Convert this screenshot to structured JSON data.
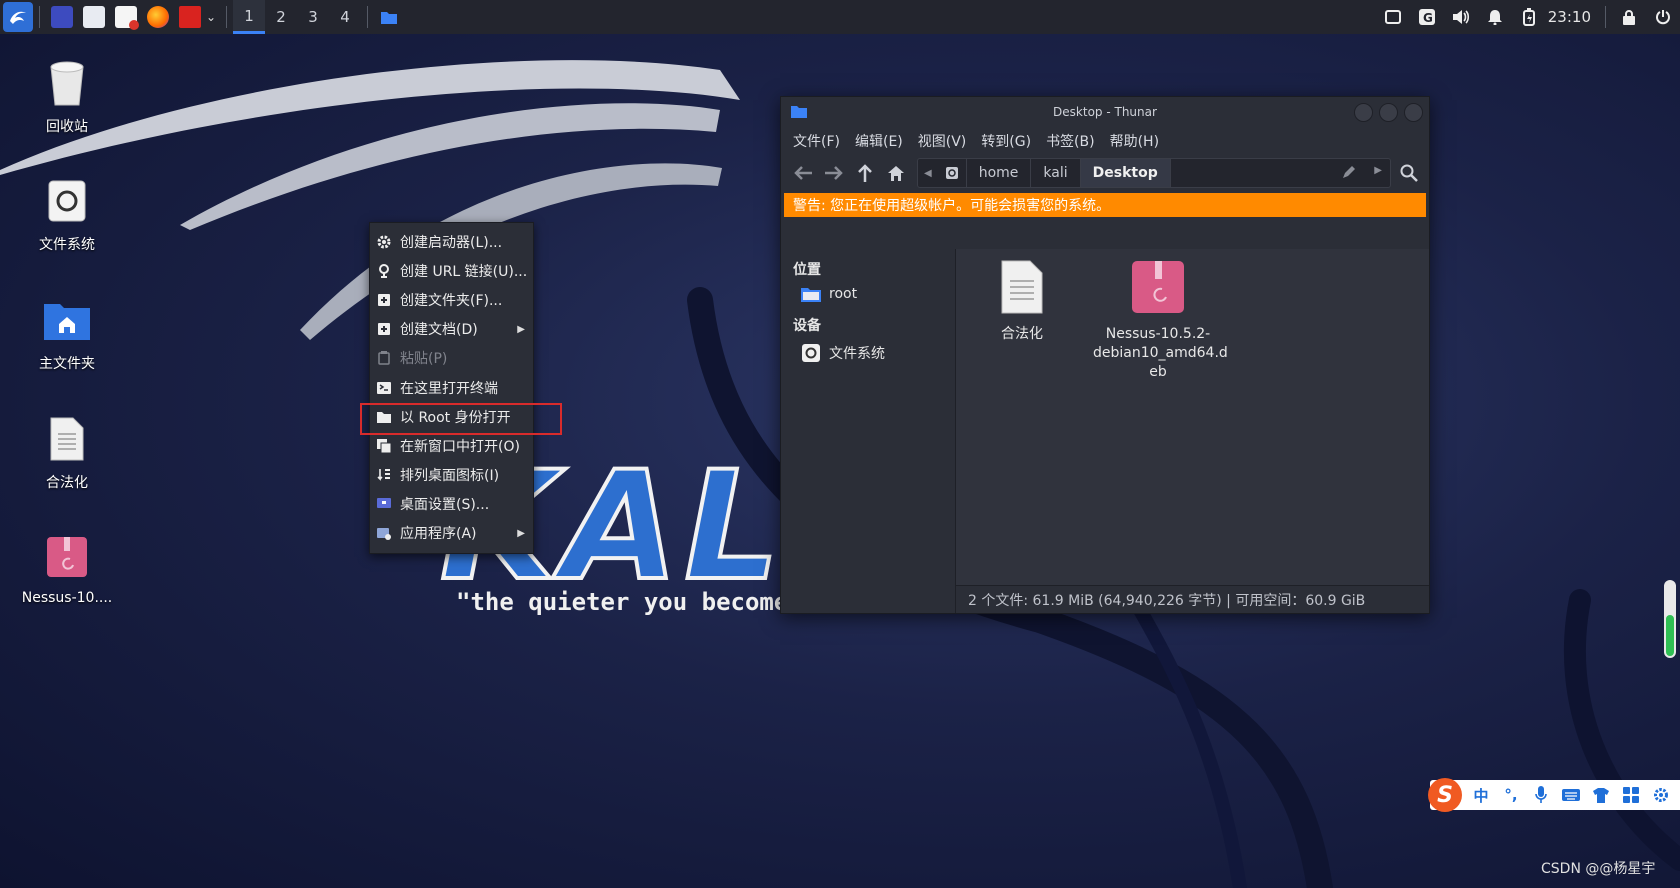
{
  "panel": {
    "workspaces": [
      "1",
      "2",
      "3",
      "4"
    ],
    "active_workspace": "1",
    "clock": "23:10",
    "launchers": [
      "terminal-icon",
      "file-manager-icon",
      "text-editor-icon",
      "firefox-icon",
      "flag-app-icon"
    ],
    "tray": [
      "screen-icon",
      "g-app-icon",
      "volume-icon",
      "notification-bell-icon",
      "battery-icon",
      "lock-icon"
    ]
  },
  "desktop_icons": [
    {
      "label": "回收站",
      "icon": "trash-icon"
    },
    {
      "label": "文件系统",
      "icon": "drive-icon"
    },
    {
      "label": "主文件夹",
      "icon": "home-folder-icon"
    },
    {
      "label": "合法化",
      "icon": "text-document-icon"
    },
    {
      "label": "Nessus-10....",
      "icon": "deb-package-icon"
    }
  ],
  "context_menu": {
    "items": [
      {
        "label": "创建启动器(L)...",
        "icon": "gear-icon",
        "disabled": false,
        "submenu": false
      },
      {
        "label": "创建 URL 链接(U)...",
        "icon": "link-icon",
        "disabled": false,
        "submenu": false
      },
      {
        "label": "创建文件夹(F)...",
        "icon": "new-folder-icon",
        "disabled": false,
        "submenu": false
      },
      {
        "label": "创建文档(D)",
        "icon": "new-document-icon",
        "disabled": false,
        "submenu": true
      },
      {
        "label": "粘贴(P)",
        "icon": "paste-icon",
        "disabled": true,
        "submenu": false
      },
      {
        "label": "在这里打开终端",
        "icon": "terminal-icon",
        "disabled": false,
        "submenu": false
      },
      {
        "label": "以 Root 身份打开",
        "icon": "folder-icon",
        "disabled": false,
        "submenu": false
      },
      {
        "label": "在新窗口中打开(O)",
        "icon": "new-window-icon",
        "disabled": false,
        "submenu": false
      },
      {
        "label": "排列桌面图标(I)",
        "icon": "sort-icon",
        "disabled": false,
        "submenu": false
      },
      {
        "label": "桌面设置(S)...",
        "icon": "desktop-settings-icon",
        "disabled": false,
        "submenu": false
      },
      {
        "label": "应用程序(A)",
        "icon": "applications-icon",
        "disabled": false,
        "submenu": true
      }
    ],
    "highlight_color": "#d92b2b"
  },
  "thunar": {
    "title": "Desktop - Thunar",
    "menus": [
      "文件(F)",
      "编辑(E)",
      "视图(V)",
      "转到(G)",
      "书签(B)",
      "帮助(H)"
    ],
    "path": [
      "home",
      "kali",
      "Desktop"
    ],
    "warning": "警告: 您正在使用超级帐户。可能会损害您的系统。",
    "warning_color": "#ff8a00",
    "sidebar": {
      "places_header": "位置",
      "places": [
        {
          "label": "root",
          "icon": "folder-icon"
        }
      ],
      "devices_header": "设备",
      "devices": [
        {
          "label": "文件系统",
          "icon": "drive-icon"
        }
      ]
    },
    "files": [
      {
        "name": "合法化",
        "icon": "text-document-icon"
      },
      {
        "name": "Nessus-10.5.2-debian10_amd64.deb",
        "lines": [
          "Nessus-10.5.2-",
          "debian10_amd64.d",
          "eb"
        ],
        "icon": "deb-package-icon"
      }
    ],
    "status": "2 个文件: 61.9 MiB (64,940,226 字节) | 可用空间：60.9 GiB"
  },
  "wallpaper": {
    "logo_text": "KALI",
    "slogan": "\"the quieter you become,"
  },
  "ime_bar": {
    "mode": "中",
    "icons": [
      "sogou-logo-icon",
      "punctuation-icon",
      "microphone-icon",
      "keyboard-icon",
      "skin-icon",
      "apps-grid-icon",
      "settings-icon"
    ]
  },
  "watermark": "CSDN @@杨星宇",
  "gauge_level": 0.55
}
